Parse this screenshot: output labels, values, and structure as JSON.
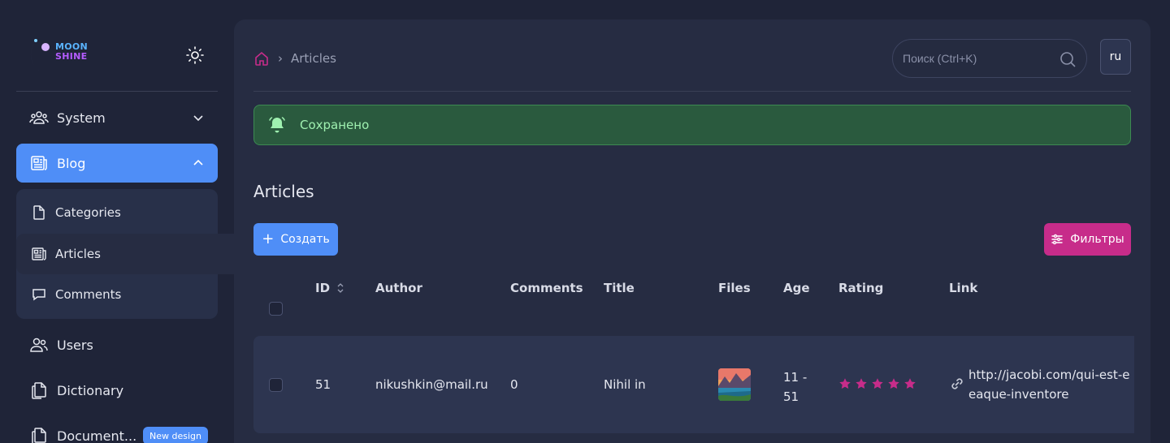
{
  "brand": {
    "line1": "MOON",
    "line2": "SHINE"
  },
  "sidebar": {
    "items": [
      {
        "label": "System"
      },
      {
        "label": "Blog"
      },
      {
        "label": "Users"
      },
      {
        "label": "Dictionary"
      },
      {
        "label": "Document...",
        "badge": "New design"
      }
    ],
    "blog_sub": [
      {
        "label": "Categories"
      },
      {
        "label": "Articles"
      },
      {
        "label": "Comments"
      }
    ]
  },
  "header": {
    "breadcrumb": "Articles",
    "search_placeholder": "Поиск (Ctrl+K)",
    "lang": "ru"
  },
  "toast": {
    "message": "Сохранено"
  },
  "page": {
    "title": "Articles",
    "create_label": "Создать",
    "filters_label": "Фильтры"
  },
  "table": {
    "columns": [
      "ID",
      "Author",
      "Comments",
      "Title",
      "Files",
      "Age",
      "Rating",
      "Link"
    ],
    "rows": [
      {
        "id": "51",
        "author": "nikushkin@mail.ru",
        "comments": "0",
        "title": "Nihil in",
        "age_line1": "11 -",
        "age_line2": "51",
        "rating": 5,
        "link_line1": "http://jacobi.com/qui-est-e",
        "link_line2": "eaque-inventore"
      }
    ]
  },
  "colors": {
    "accent": "#4f8ef7",
    "pink": "#c72c8a",
    "success_bg": "#2a5a3e",
    "success_text": "#9ff0b0",
    "panel": "#262c42",
    "bg": "#1f2438"
  }
}
